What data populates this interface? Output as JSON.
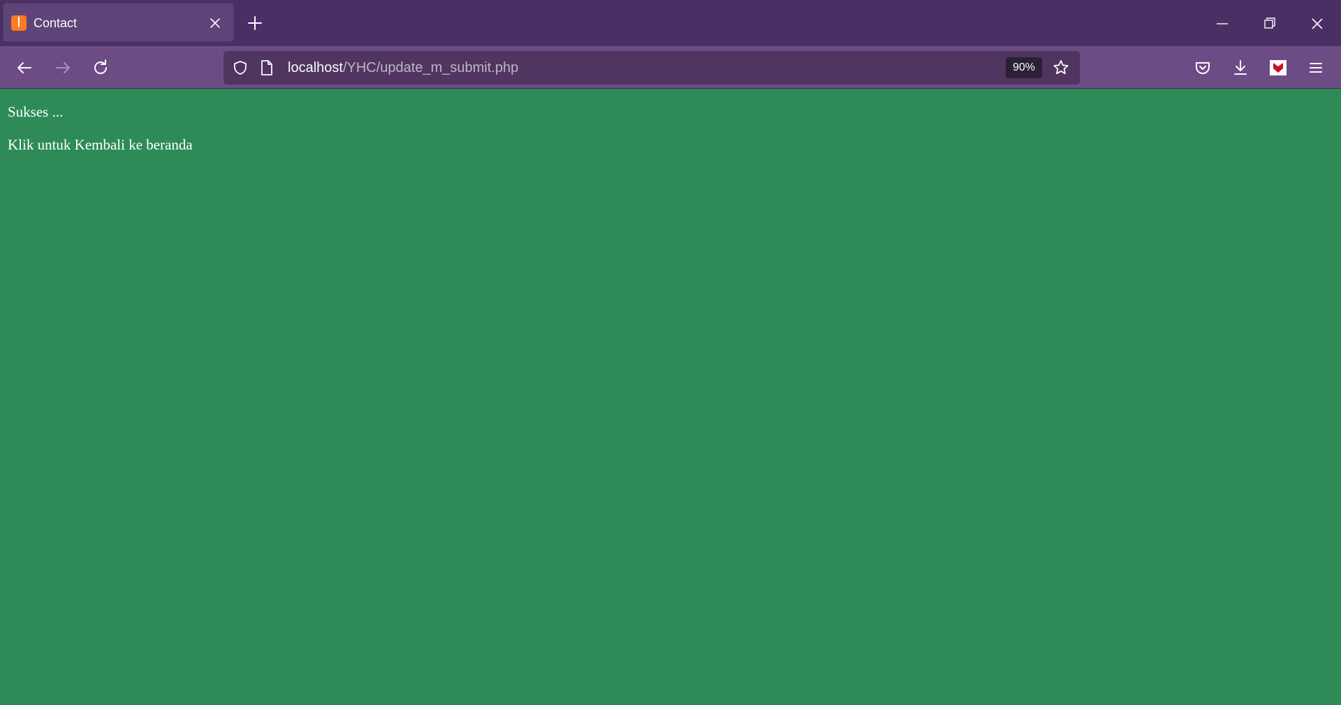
{
  "window": {
    "tab_title": "Contact",
    "new_tab_icon": "plus-icon",
    "controls": [
      "minimize-icon",
      "restore-icon",
      "close-icon"
    ]
  },
  "toolbar": {
    "back_icon": "arrow-left-icon",
    "forward_icon": "arrow-right-icon",
    "reload_icon": "reload-icon",
    "url_host": "localhost",
    "url_path": "/YHC/update_m_submit.php",
    "zoom": "90%",
    "right_icons": [
      "pocket-icon",
      "download-icon",
      "extension-icon",
      "menu-icon"
    ]
  },
  "page": {
    "message": "Sukses ...",
    "back_link": "Klik untuk Kembali ke beranda"
  },
  "colors": {
    "tabstrip": "#4a2f64",
    "toolbar": "#6d4c85",
    "urlbar": "#4f355f",
    "page_background": "#2e8b57",
    "text": "#ffffff"
  }
}
